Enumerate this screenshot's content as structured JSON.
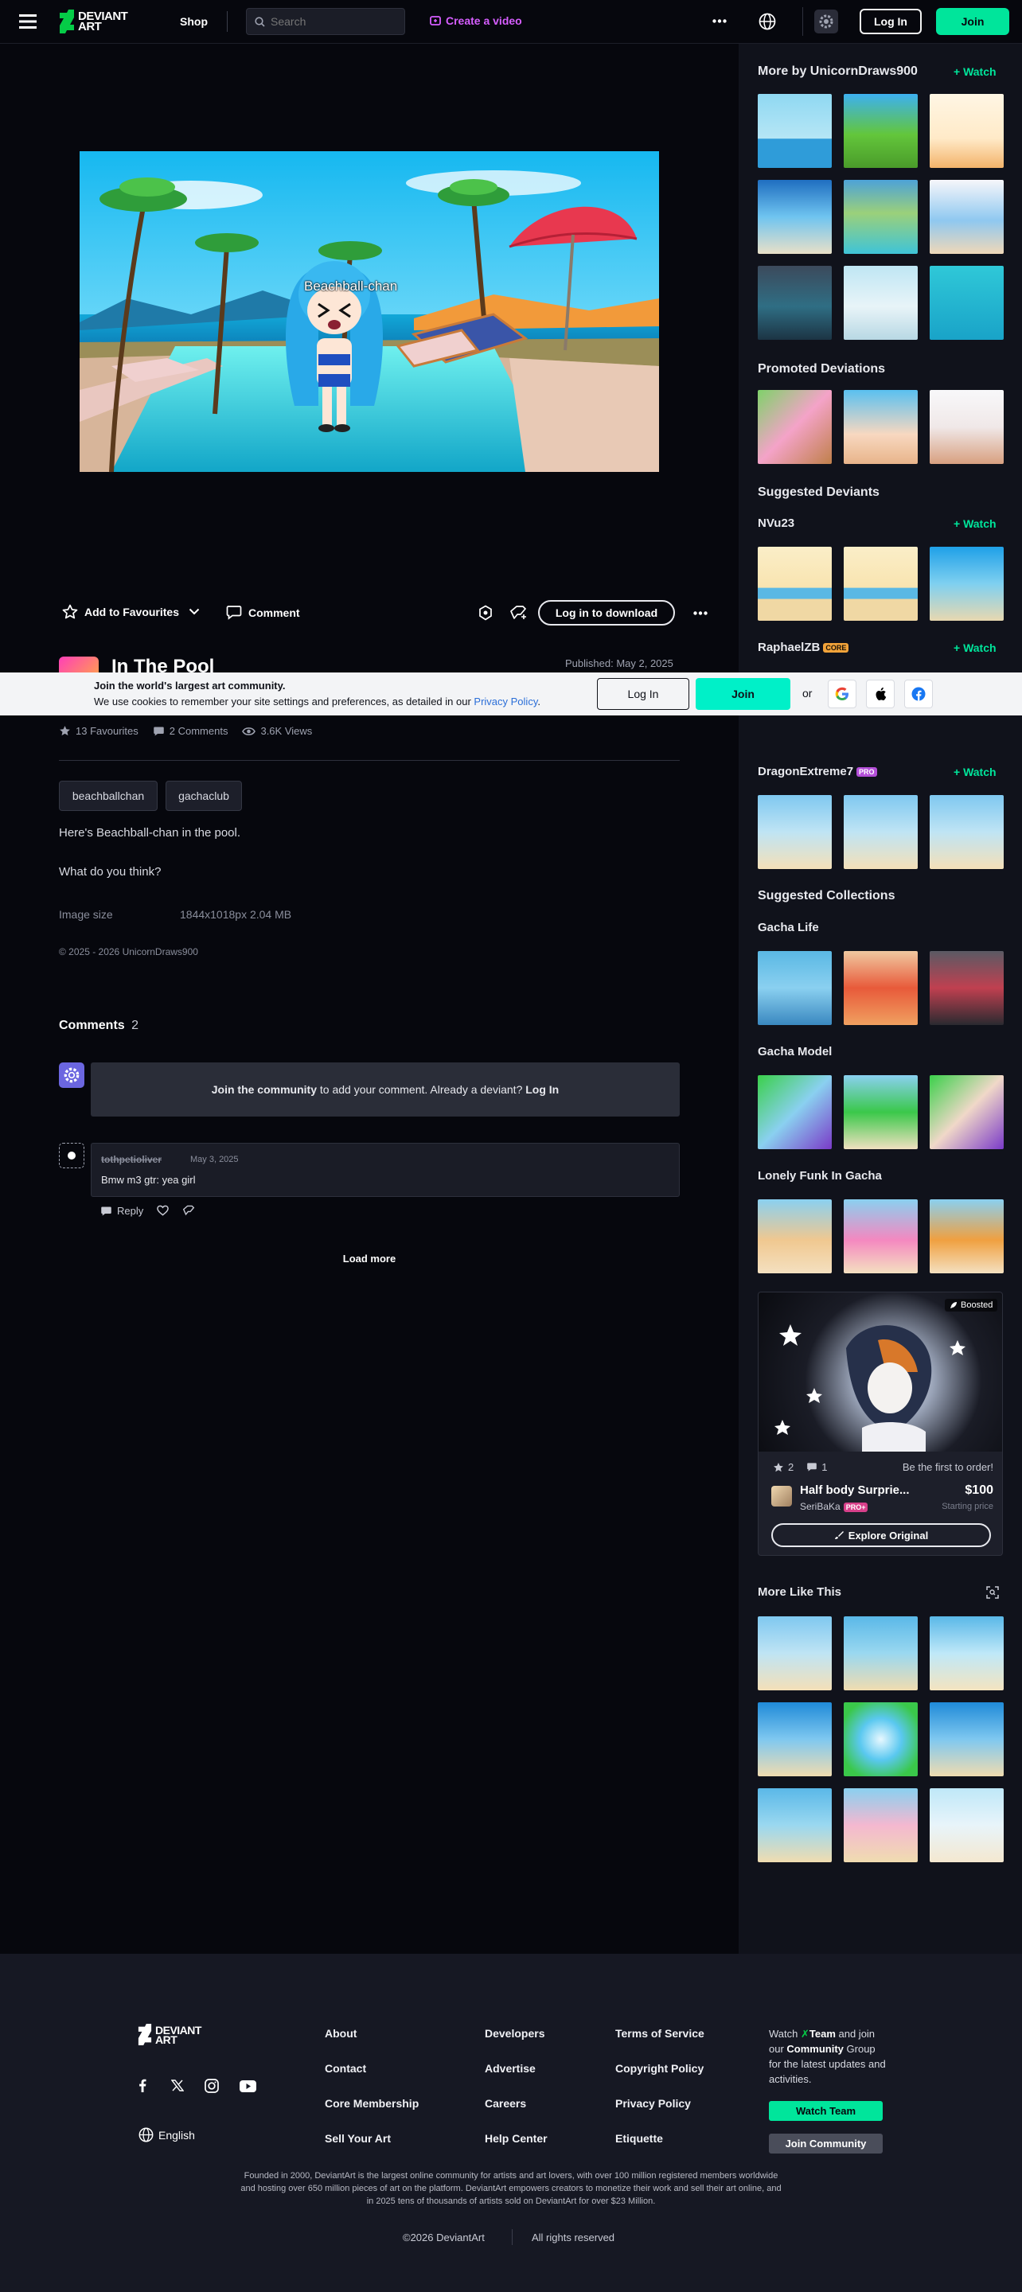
{
  "header": {
    "logo_line1": "DEVIANT",
    "logo_line2": "ART",
    "shop": "Shop",
    "search_placeholder": "Search",
    "create": "Create a video",
    "login": "Log In",
    "join": "Join"
  },
  "artwork": {
    "overlay_caption": "Beachball-chan",
    "add_fav": "Add to Favourites",
    "comment": "Comment",
    "download": "Log in to download",
    "title": "In The Pool",
    "published": "Published: May 2, 2025",
    "stats": {
      "favourites": "13 Favourites",
      "comments": "2 Comments",
      "views": "3.6K Views"
    },
    "tags": [
      "beachballchan",
      "gachaclub"
    ],
    "description_1": "Here's Beachball-chan in the pool.",
    "description_2": "What do you think?",
    "image_size_label": "Image size",
    "image_size_value": "1844x1018px 2.04 MB",
    "copyright": "© 2025 - 2026 UnicornDraws900"
  },
  "comments": {
    "heading": "Comments",
    "count": "2",
    "join_bold": "Join the community",
    "join_rest": " to add your comment. Already a deviant? ",
    "join_login": "Log In",
    "item": {
      "user": "tothpetioliver",
      "date": "May 3, 2025",
      "text": "Bmw m3 gtr: yea girl",
      "reply": "Reply"
    },
    "load_more": "Load more"
  },
  "cookie": {
    "title": "Join the world's largest art community.",
    "text": "We use cookies to remember your site settings and preferences, as detailed in our ",
    "link": "Privacy Policy",
    "end": ".",
    "login": "Log In",
    "join": "Join",
    "or": "or"
  },
  "sidebar": {
    "more_by": "More by UnicornDraws900",
    "watch": "Watch",
    "promoted": "Promoted Deviations",
    "suggested_deviants": "Suggested Deviants",
    "deviant_1": "NVu23",
    "deviant_2": "RaphaelZB",
    "deviant_2_badge": "CORE",
    "deviant_3": "DragonExtreme7",
    "deviant_3_badge": "PRO",
    "suggested_collections": "Suggested Collections",
    "col_1": "Gacha Life",
    "col_2": "Gacha Model",
    "col_3": "Lonely Funk In Gacha",
    "boosted": "Boosted",
    "boost_favs": "2",
    "boost_comments": "1",
    "boost_order": "Be the first to order!",
    "boost_title": "Half body Surprie...",
    "boost_price": "$100",
    "boost_user": "SeriBaKa",
    "boost_user_badge": "PRO+",
    "boost_starting": "Starting price",
    "explore": "Explore Original",
    "more_like": "More Like This"
  },
  "footer": {
    "logo_line1": "DEVIANT",
    "logo_line2": "ART",
    "col1": [
      "About",
      "Contact",
      "Core Membership",
      "Sell Your Art"
    ],
    "col2": [
      "Developers",
      "Advertise",
      "Careers",
      "Help Center"
    ],
    "col3": [
      "Terms of Service",
      "Copyright Policy",
      "Privacy Policy",
      "Etiquette"
    ],
    "language": "English",
    "watch_pre": "Watch ",
    "watch_team": "Team",
    "watch_mid": " and join our ",
    "watch_community": "Community",
    "watch_post": " Group for the latest updates and activities.",
    "watch_team_btn": "Watch Team",
    "join_community_btn": "Join Community",
    "about_text": "Founded in 2000, DeviantArt is the largest online community for artists and art lovers, with over 100 million registered members worldwide and hosting over 650 million pieces of art on the platform. DeviantArt empowers creators to monetize their work and sell their art online, and in 2025 tens of thousands of artists sold on DeviantArt for over $23 Million.",
    "copyright": "©2026 DeviantArt",
    "rights": "All rights reserved"
  }
}
